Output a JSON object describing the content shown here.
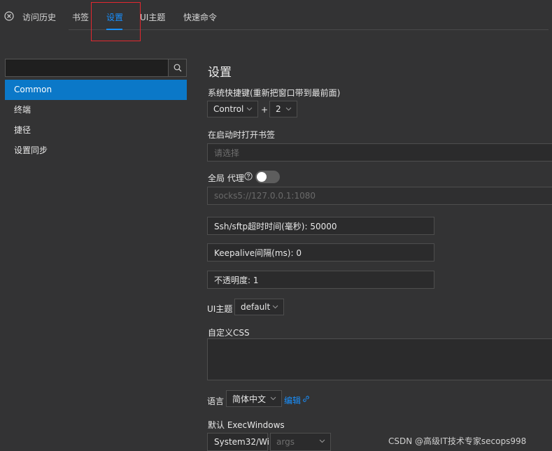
{
  "tabs": {
    "close_icon": "close-circle-icon",
    "items": [
      {
        "label": "访问历史"
      },
      {
        "label": "书签"
      },
      {
        "label": "设置"
      },
      {
        "label": "UI主题"
      },
      {
        "label": "快速命令"
      }
    ],
    "active": "设置",
    "accent_color": "#1890ff",
    "highlight_color": "#e3282f"
  },
  "sidebar": {
    "search": {
      "value": "",
      "placeholder": "",
      "icon": "search-icon"
    },
    "items": [
      {
        "label": "Common"
      },
      {
        "label": "终端"
      },
      {
        "label": "捷径"
      },
      {
        "label": "设置同步"
      }
    ],
    "active_color": "#0b78c8"
  },
  "settings": {
    "title": "设置",
    "shortcut": {
      "label": "系统快捷键(重新把窗口带到最前面)",
      "modifier": "Control",
      "plus": "+",
      "key": "2"
    },
    "bookmarks": {
      "label": "在启动时打开书签",
      "placeholder": "请选择"
    },
    "proxy": {
      "label": "全局 代理",
      "enabled": false,
      "placeholder": "socks5://127.0.0.1:1080"
    },
    "ssh_timeout": "Ssh/sftp超时时间(毫秒): 50000",
    "keepalive": "Keepalive间隔(ms): 0",
    "opacity": "不透明度: 1",
    "ui_theme": {
      "label": "UI主题",
      "value": "default"
    },
    "custom_css": {
      "label": "自定义CSS",
      "value": ""
    },
    "language": {
      "label": "语言",
      "value": "简体中文",
      "edit": "编辑"
    },
    "exec_windows": {
      "label": "默认 ExecWindows",
      "path": "System32/Wi",
      "args_placeholder": "args"
    }
  },
  "watermark": "CSDN @高级IT技术专家secops998"
}
